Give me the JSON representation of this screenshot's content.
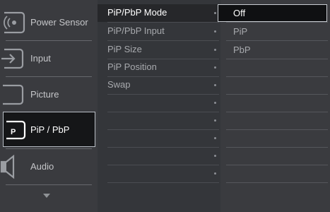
{
  "left_menu": {
    "items": [
      {
        "label": "Power Sensor",
        "icon": "power-sensor-icon",
        "active": false
      },
      {
        "label": "Input",
        "icon": "input-icon",
        "active": false
      },
      {
        "label": "Picture",
        "icon": "picture-icon",
        "active": false
      },
      {
        "label": "PiP / PbP",
        "icon": "pip-icon",
        "active": true
      },
      {
        "label": "Audio",
        "icon": "speaker-icon",
        "active": false
      }
    ],
    "more_icon": "chevron-down-icon"
  },
  "submenu": {
    "items": [
      {
        "label": "PiP/PbP Mode",
        "selected": true
      },
      {
        "label": "PiP/PbP Input",
        "selected": false
      },
      {
        "label": "PiP Size",
        "selected": false
      },
      {
        "label": "PiP Position",
        "selected": false
      },
      {
        "label": "Swap",
        "selected": false
      }
    ]
  },
  "options": {
    "items": [
      {
        "label": "Off",
        "selected": true
      },
      {
        "label": "PiP",
        "selected": false
      },
      {
        "label": "PbP",
        "selected": false
      }
    ]
  },
  "colors": {
    "background": "#3a3b3f",
    "active_border": "#b9bfc6",
    "active_fill": "#151618",
    "text": "#c5c6c9"
  }
}
